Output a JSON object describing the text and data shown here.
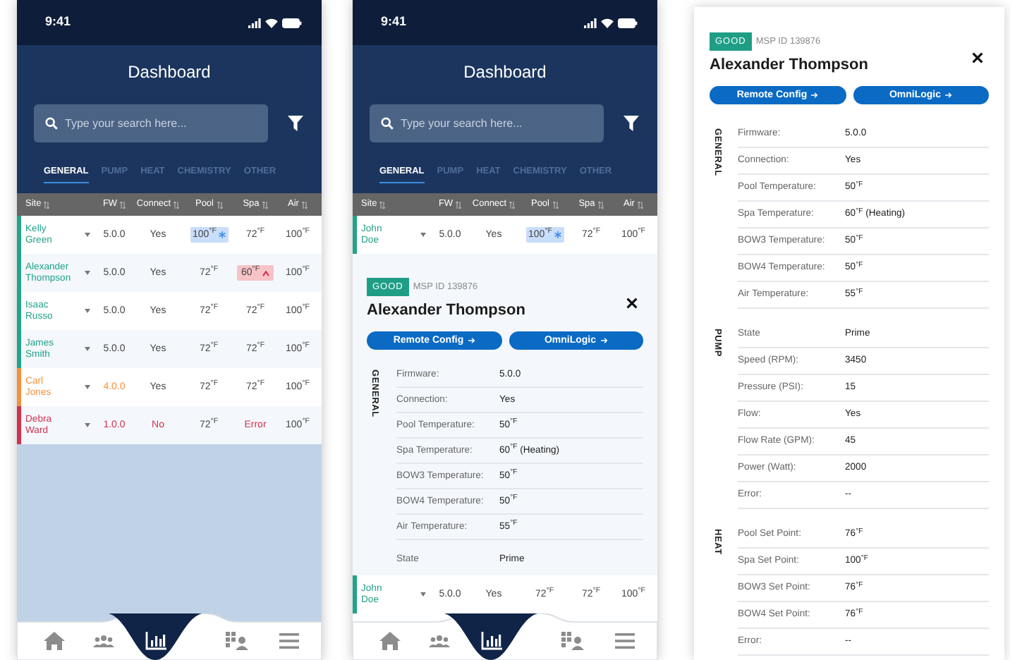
{
  "list_screen": {
    "status_bar": {
      "time": "9:41"
    },
    "title": "Dashboard",
    "search": {
      "placeholder": "Type your search here..."
    },
    "tabs": [
      {
        "label": "GENERAL",
        "selected": true
      },
      {
        "label": "PUMP",
        "selected": false
      },
      {
        "label": "HEAT",
        "selected": false
      },
      {
        "label": "CHEMISTRY",
        "selected": false
      },
      {
        "label": "OTHER",
        "selected": false
      }
    ],
    "columns": [
      "Site",
      "FW",
      "Connect",
      "Pool",
      "Spa",
      "Air"
    ],
    "rows": [
      {
        "site": "Kelly Green",
        "color": "#22a38b",
        "fw": {
          "text": "5.0.0"
        },
        "connect": {
          "text": "Yes"
        },
        "pool": {
          "text": "100$^{°F}$",
          "cold": true
        },
        "spa": {
          "text": "72$^{°F}$"
        },
        "air": {
          "text": "100$^{°F}$"
        }
      },
      {
        "site": "Alexander Thompson",
        "color": "#22a38b",
        "fw": {
          "text": "5.0.0"
        },
        "connect": {
          "text": "Yes"
        },
        "pool": {
          "text": "72$^{°F}$"
        },
        "spa": {
          "text": "60$^{°F}$",
          "hot": true
        },
        "air": {
          "text": "100$^{°F}$"
        }
      },
      {
        "site": "Isaac Russo",
        "color": "#22a38b",
        "fw": {
          "text": "5.0.0"
        },
        "connect": {
          "text": "Yes"
        },
        "pool": {
          "text": "72$^{°F}$"
        },
        "spa": {
          "text": "72$^{°F}$"
        },
        "air": {
          "text": "100$^{°F}$"
        }
      },
      {
        "site": "James Smith",
        "color": "#22a38b",
        "fw": {
          "text": "5.0.0"
        },
        "connect": {
          "text": "Yes"
        },
        "pool": {
          "text": "72$^{°F}$"
        },
        "spa": {
          "text": "72$^{°F}$"
        },
        "air": {
          "text": "100$^{°F}$"
        }
      },
      {
        "site": "Carl Jones",
        "color": "#f5913c",
        "fw": {
          "text": "4.0.0",
          "alert": true
        },
        "connect": {
          "text": "Yes"
        },
        "pool": {
          "text": "72$^{°F}$"
        },
        "spa": {
          "text": "72$^{°F}$"
        },
        "air": {
          "text": "100$^{°F}$"
        }
      },
      {
        "site": "Debra Ward",
        "color": "#d2304f",
        "fw": {
          "text": "1.0.0",
          "alert": true
        },
        "connect": {
          "text": "No",
          "alert": true
        },
        "pool": {
          "text": "72$^{°F}$"
        },
        "spa": {
          "text": "Error",
          "alert": true
        },
        "air": {
          "text": "100$^{°F}$"
        }
      }
    ],
    "nav": [
      {
        "selected": false
      },
      {
        "selected": false
      },
      {
        "selected": true
      },
      {
        "selected": false
      },
      {
        "selected": false
      }
    ]
  },
  "detail_screen": {
    "status_bar": {
      "time": "9:41"
    },
    "title": "Dashboard",
    "search": {
      "placeholder": "Type your search here..."
    },
    "tabs": [
      {
        "label": "GENERAL",
        "selected": true
      },
      {
        "label": "PUMP",
        "selected": false
      },
      {
        "label": "HEAT",
        "selected": false
      },
      {
        "label": "CHEMISTRY",
        "selected": false
      },
      {
        "label": "OTHER",
        "selected": false
      }
    ],
    "columns": [
      "Site",
      "FW",
      "Connect",
      "Pool",
      "Spa",
      "Air"
    ],
    "rows": [
      {
        "site": "John Doe",
        "color": "#22a38b",
        "fw": {
          "text": "5.0.0"
        },
        "connect": {
          "text": "Yes"
        },
        "pool": {
          "text": "100$^{°F}$",
          "cold": true
        },
        "spa": {
          "text": "72$^{°F}$"
        },
        "air": {
          "text": "100$^{°F}$"
        }
      }
    ],
    "detail": {
      "status": "GOOD",
      "msp_id": "MSP ID 139876",
      "name": "Alexander Thompson",
      "buttons": [
        "Remote Config",
        "OmniLogic"
      ],
      "sections": [
        {
          "label": "GENERAL",
          "rows": [
            {
              "label": "Firmware:",
              "value": "5.0.0"
            },
            {
              "label": "Connection:",
              "value": "Yes"
            },
            {
              "label": "Pool Temperature:",
              "value": "50$^{°F}$"
            },
            {
              "label": "Spa Temperature:",
              "value": "60$^{°F}$ (Heating)"
            },
            {
              "label": "BOW3 Temperature:",
              "value": "50$^{°F}$"
            },
            {
              "label": "BOW4 Temperature:",
              "value": "50$^{°F}$"
            },
            {
              "label": "Air Temperature:",
              "value": "55$^{°F}$"
            }
          ]
        },
        {
          "rows": [
            {
              "label": "State",
              "value": "Prime"
            }
          ]
        }
      ]
    },
    "pinned_row": {
      "site": "John Doe",
      "color": "#22a38b",
      "fw": {
        "text": "5.0.0"
      },
      "connect": {
        "text": "Yes"
      },
      "pool": {
        "text": "72$^{°F}$"
      },
      "spa": {
        "text": "72$^{°F}$"
      },
      "air": {
        "text": "100$^{°F}$"
      }
    },
    "nav": [
      {
        "selected": false
      },
      {
        "selected": false
      },
      {
        "selected": true
      },
      {
        "selected": false
      },
      {
        "selected": false
      }
    ]
  },
  "detail_card": {
    "status": "GOOD",
    "msp_id": "MSP ID 139876",
    "name": "Alexander Thompson",
    "buttons": [
      "Remote Config",
      "OmniLogic"
    ],
    "sections": [
      {
        "label": "GENERAL",
        "rows": [
          {
            "label": "Firmware:",
            "value": "5.0.0"
          },
          {
            "label": "Connection:",
            "value": "Yes"
          },
          {
            "label": "Pool Temperature:",
            "value": "50$^{°F}$"
          },
          {
            "label": "Spa Temperature:",
            "value": "60$^{°F}$ (Heating)"
          },
          {
            "label": "BOW3 Temperature:",
            "value": "50$^{°F}$"
          },
          {
            "label": "BOW4 Temperature:",
            "value": "50$^{°F}$"
          },
          {
            "label": "Air Temperature:",
            "value": "55$^{°F}$"
          }
        ]
      },
      {
        "label": "PUMP",
        "rows": [
          {
            "label": "State",
            "value": "Prime"
          },
          {
            "label": "Speed (RPM):",
            "value": "3450"
          },
          {
            "label": "Pressure (PSI):",
            "value": "15"
          },
          {
            "label": "Flow:",
            "value": "Yes"
          },
          {
            "label": "Flow Rate (GPM):",
            "value": "45"
          },
          {
            "label": "Power (Watt):",
            "value": "2000"
          },
          {
            "label": "Error:",
            "value": "--"
          }
        ]
      },
      {
        "label": "HEAT",
        "rows": [
          {
            "label": "Pool Set Point:",
            "value": "76$^{°F}$"
          },
          {
            "label": "Spa Set Point:",
            "value": "100$^{°F}$"
          },
          {
            "label": "BOW3 Set Point:",
            "value": "76$^{°F}$"
          },
          {
            "label": "BOW4 Set Point:",
            "value": "76$^{°F}$"
          },
          {
            "label": "Error:",
            "value": "--"
          }
        ]
      }
    ]
  }
}
